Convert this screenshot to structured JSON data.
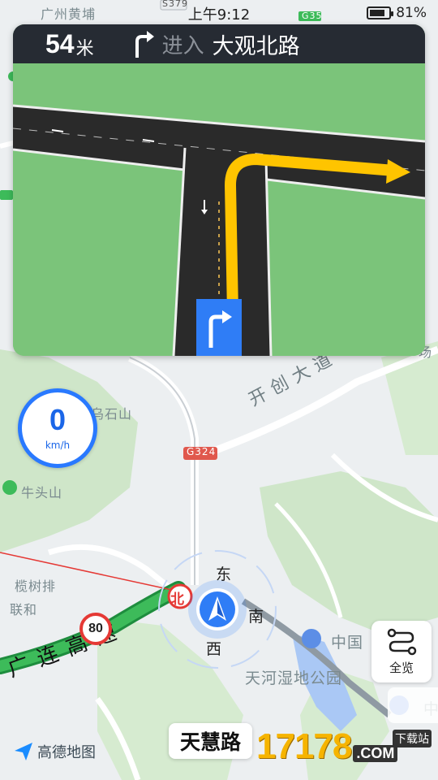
{
  "status_bar": {
    "time": "上午9:12",
    "battery": "81%",
    "battery_level": 0.81
  },
  "guidance": {
    "distance": "54",
    "distance_unit": "米",
    "action": "进入",
    "road": "大观北路",
    "turn_icon": "turn-right-icon"
  },
  "speed": {
    "value": "0",
    "unit": "km/h"
  },
  "speed_limit": "80",
  "compass": {
    "north": "北",
    "east": "东",
    "south": "南",
    "west": "西"
  },
  "map_labels": {
    "guangzhou_huangpu": "广州黄埔",
    "s379": "S379",
    "g35": "G35",
    "wushishan": "乌石山",
    "kaichuang": "开创大道",
    "g324": "G324",
    "niutoushan": "牛头山",
    "lanshupai": "榄树排",
    "lianhe": "联和",
    "highway": "广连高速",
    "zhongguo": "中国",
    "wetland": "天河湿地公园",
    "chang": "场",
    "zhong_right": "中"
  },
  "overview": {
    "label": "全览",
    "icon": "route-overview-icon"
  },
  "current_road": "天慧路",
  "logo": "高德地图",
  "watermark": {
    "number": "17178",
    "com": ".COM",
    "download": "下载站"
  },
  "colors": {
    "accent": "#2979ff",
    "route": "#3dbb5a",
    "header_bg": "#262b33",
    "turn_path": "#ffc400"
  }
}
